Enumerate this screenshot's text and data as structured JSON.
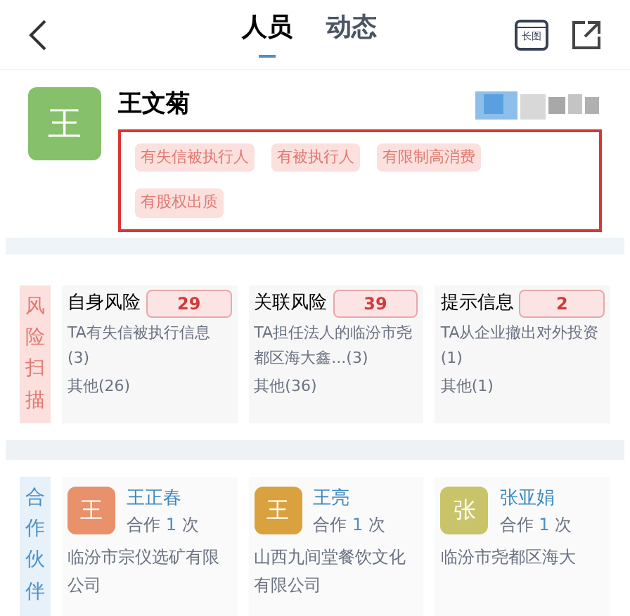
{
  "header": {
    "tabs": [
      {
        "label": "人员",
        "selected": true
      },
      {
        "label": "动态",
        "selected": false
      }
    ],
    "long_image_icon_text": "长图"
  },
  "person": {
    "avatar": "王",
    "name": "王文菊",
    "tags": [
      "有失信被执行人",
      "有被执行人",
      "有限制高消费",
      "有股权出质"
    ]
  },
  "risk_scan": {
    "label": "风险扫描",
    "cards": [
      {
        "title": "自身风险",
        "count": "29",
        "lines": [
          "TA有失信被执行信息(3)",
          "其他(26)"
        ]
      },
      {
        "title": "关联风险",
        "count": "39",
        "lines": [
          "TA担任法人的临汾市尧都区海大鑫...(3)",
          "其他(36)"
        ]
      },
      {
        "title": "提示信息",
        "count": "2",
        "lines": [
          "TA从企业撤出对外投资(1)",
          "其他(1)"
        ]
      }
    ]
  },
  "partners": {
    "label": "合作伙伴",
    "items": [
      {
        "avatar": "王",
        "color": "#e8916a",
        "name": "王正春",
        "collab": "合作",
        "count": "1",
        "unit": "次",
        "company": "临汾市宗仪选矿有限公司"
      },
      {
        "avatar": "王",
        "color": "#d9a23e",
        "name": "王亮",
        "collab": "合作",
        "count": "1",
        "unit": "次",
        "company": "山西九间堂餐饮文化有限公司"
      },
      {
        "avatar": "张",
        "color": "#c9c46a",
        "name": "张亚娟",
        "collab": "合作",
        "count": "1",
        "unit": "次",
        "company": "临汾市尧都区海大"
      }
    ]
  }
}
